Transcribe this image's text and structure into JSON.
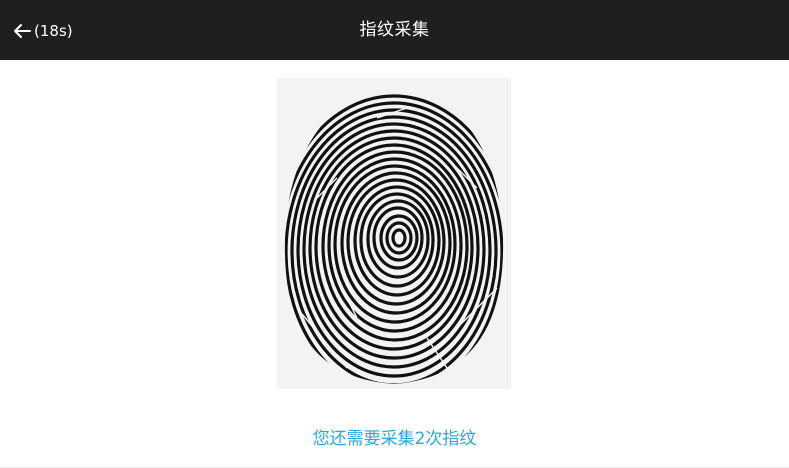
{
  "header": {
    "back_icon": "arrow-left-icon",
    "countdown": "(18s)",
    "title": "指纹采集"
  },
  "main": {
    "fingerprint_image": "fingerprint-scan",
    "hint": "您还需要采集2次指纹"
  },
  "colors": {
    "topbar": "#1f1f1f",
    "hint": "#2aa9e0",
    "background": "#ffffff"
  }
}
